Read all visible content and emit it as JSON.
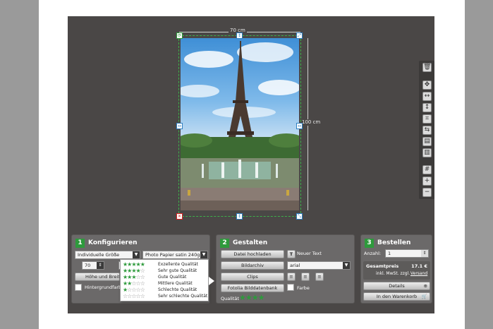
{
  "canvas": {
    "width_label": "70 cm",
    "height_label": "100 cm"
  },
  "panel1": {
    "number": "1",
    "title": "Konfigurieren",
    "size_select": "Individuelle Größe",
    "paper_select": "Photo Papier satin 240g",
    "width_value": "70",
    "ratio_button": "Höhe und Breite",
    "bg_color_label": "Hintergrundfarbe"
  },
  "quality_popup": {
    "rows": [
      {
        "stars": 5,
        "label": "Exzellente Qualität"
      },
      {
        "stars": 4,
        "label": "Sehr gute Qualität"
      },
      {
        "stars": 3,
        "label": "Gute Qualität"
      },
      {
        "stars": 2,
        "label": "Mittlere Qualität"
      },
      {
        "stars": 1,
        "label": "Schlechte Qualität"
      },
      {
        "stars": 0,
        "label": "Sehr schlechte Qualität"
      }
    ]
  },
  "panel2": {
    "number": "2",
    "title": "Gestalten",
    "upload_button": "Datei hochladen",
    "archive_button": "Bildarchiv",
    "clips_button": "Clips",
    "fotolia_button": "Fotolia Bilddatenbank",
    "new_text_label": "Neuer Text",
    "font_select": "arial",
    "color_label": "Farbe",
    "quality_label": "Qualität",
    "quality_stars": 4
  },
  "panel3": {
    "number": "3",
    "title": "Bestellen",
    "quantity_label": "Anzahl:",
    "quantity_value": "1",
    "total_label": "Gesamtpreis",
    "total_value": "17.1 €",
    "vat_text": "inkl. MwSt. zzgl.",
    "shipping_link": "Versand",
    "details_button": "Details",
    "cart_button": "In den Warenkorb"
  },
  "colors": {
    "accent_green": "#2e9a3c",
    "handle_blue": "#2f7fc0",
    "editor_bg": "#4a4746"
  }
}
